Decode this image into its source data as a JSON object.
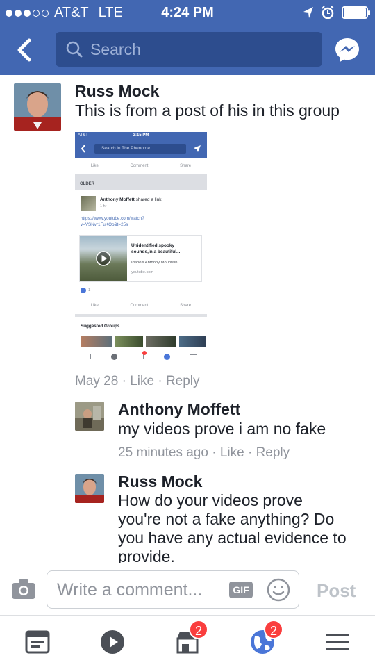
{
  "status_bar": {
    "carrier": "AT&T",
    "network": "LTE",
    "time": "4:24 PM"
  },
  "header": {
    "search_placeholder": "Search"
  },
  "comments": [
    {
      "author": "Russ Mock",
      "text": "This is from a post of his in this group",
      "date": "May 28",
      "like": "Like",
      "reply": "Reply"
    },
    {
      "author": "Anthony Moffett",
      "text": "my videos prove i am no fake",
      "date": "25 minutes ago",
      "like": "Like",
      "reply": "Reply"
    },
    {
      "author": "Russ Mock",
      "text_lines": [
        "How do your videos prove",
        "you're not a fake anything? Do",
        "you have any actual evidence to",
        "provide."
      ]
    }
  ],
  "embedded_screenshot": {
    "carrier": "AT&T",
    "time": "3:15 PM",
    "search": "Search in The Phenome...",
    "actions": [
      "Like",
      "Comment",
      "Share"
    ],
    "section": "OLDER",
    "poster": "Anthony Moffett",
    "shared": "shared a link.",
    "age": "1 hr",
    "link_lines": [
      "https://www.youtube.com/watch?",
      "v=VSNvr1FuKOo&t=25s"
    ],
    "card_title_lines": [
      "Unidentified spooky",
      "sounds,in a beautiful..."
    ],
    "card_desc": "Idaho's Anthony Mountain...",
    "card_domain": "youtube.com",
    "reaction_count": "1",
    "suggested": "Suggested Groups"
  },
  "composer": {
    "placeholder": "Write a comment...",
    "gif": "GIF",
    "post": "Post"
  },
  "tab_bar": {
    "marketplace_badge": "2",
    "notifications_badge": "2"
  },
  "colors": {
    "brand": "#4267b2",
    "badge": "#fa3e3e",
    "meta": "#90949c"
  }
}
